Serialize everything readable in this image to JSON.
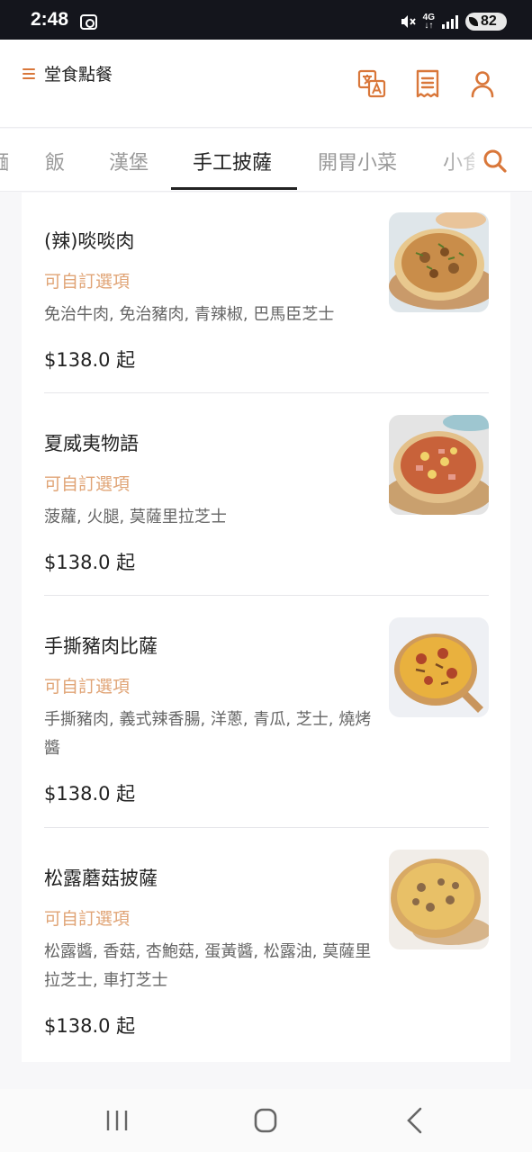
{
  "status_bar": {
    "time": "2:48",
    "network": "4G",
    "battery": "82"
  },
  "header": {
    "title": "堂食點餐",
    "icons": [
      "translate-icon",
      "receipt-icon",
      "user-icon"
    ]
  },
  "tabs": [
    {
      "label": "麵",
      "active": false
    },
    {
      "label": "飯",
      "active": false
    },
    {
      "label": "漢堡",
      "active": false
    },
    {
      "label": "手工披薩",
      "active": true
    },
    {
      "label": "開胃小菜",
      "active": false
    },
    {
      "label": "小食",
      "active": false
    }
  ],
  "items": [
    {
      "name": "(辣)啖啖肉",
      "custom": "可自訂選項",
      "desc": "免治牛肉, 免治豬肉, 青辣椒, 巴馬臣芝士",
      "price": "$138.0 起"
    },
    {
      "name": "夏威夷物語",
      "custom": "可自訂選項",
      "desc": "菠蘿, 火腿, 莫薩里拉芝士",
      "price": "$138.0 起"
    },
    {
      "name": "手撕豬肉比薩",
      "custom": "可自訂選項",
      "desc": "手撕豬肉, 義式辣香腸, 洋蔥, 青瓜, 芝士, 燒烤醬",
      "price": "$138.0 起"
    },
    {
      "name": "松露蘑菇披薩",
      "custom": "可自訂選項",
      "desc": "松露醬, 香菇, 杏鮑菇, 蛋黃醬, 松露油, 莫薩里拉芝士, 車打芝士",
      "price": "$138.0 起"
    }
  ],
  "colors": {
    "accent": "#d9773a",
    "custom_text": "#e0a476",
    "status_bar": "#14151c"
  }
}
